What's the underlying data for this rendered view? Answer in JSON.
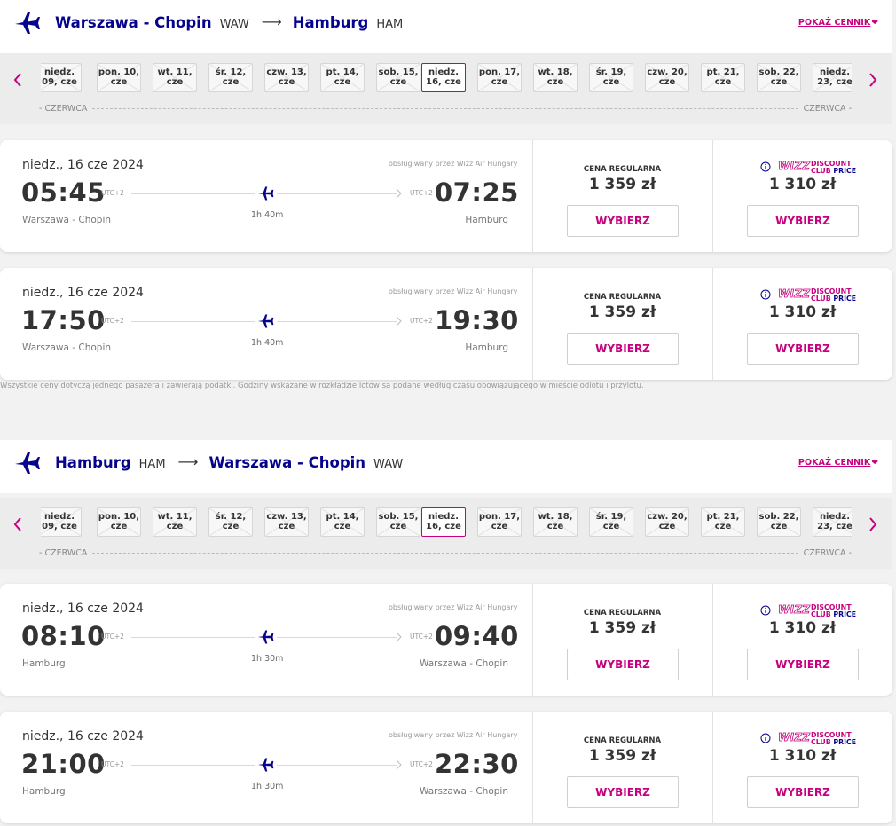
{
  "colors": {
    "brand_blue": "#06038d",
    "brand_pink": "#c6007e"
  },
  "routes": [
    {
      "from_city": "Warszawa - Chopin",
      "from_code": "WAW",
      "arrow": "⟶",
      "to_city": "Hamburg",
      "to_code": "HAM",
      "price_list_link": "POKAŻ CENNIK",
      "month_left": "CZERWCA",
      "month_right": "CZERWCA",
      "dates": [
        {
          "line1": "niedz.",
          "line2": "09, cze"
        },
        {
          "line1": "pon. 10,",
          "line2": "cze"
        },
        {
          "line1": "wt. 11,",
          "line2": "cze"
        },
        {
          "line1": "śr. 12,",
          "line2": "cze"
        },
        {
          "line1": "czw. 13,",
          "line2": "cze"
        },
        {
          "line1": "pt. 14,",
          "line2": "cze"
        },
        {
          "line1": "sob. 15,",
          "line2": "cze"
        },
        {
          "line1": "niedz.",
          "line2": "16, cze",
          "selected": true
        },
        {
          "line1": "pon. 17,",
          "line2": "cze"
        },
        {
          "line1": "wt. 18,",
          "line2": "cze"
        },
        {
          "line1": "śr. 19,",
          "line2": "cze"
        },
        {
          "line1": "czw. 20,",
          "line2": "cze"
        },
        {
          "line1": "pt. 21,",
          "line2": "cze"
        },
        {
          "line1": "sob. 22,",
          "line2": "cze"
        },
        {
          "line1": "niedz.",
          "line2": "23, cze"
        }
      ],
      "flights": [
        {
          "date": "niedz., 16 cze 2024",
          "operated_by": "obsługiwany przez Wizz Air Hungary",
          "dep_time": "05:45",
          "dep_utc": "UTC+2",
          "arr_time": "07:25",
          "arr_utc": "UTC+2",
          "duration": "1h 40m",
          "from": "Warszawa - Chopin",
          "to": "Hamburg",
          "regular_label": "CENA REGULARNA",
          "regular_price": "1 359 zł",
          "dc_price": "1 310 zł",
          "select_label": "WYBIERZ"
        },
        {
          "date": "niedz., 16 cze 2024",
          "operated_by": "obsługiwany przez Wizz Air Hungary",
          "dep_time": "17:50",
          "dep_utc": "UTC+2",
          "arr_time": "19:30",
          "arr_utc": "UTC+2",
          "duration": "1h 40m",
          "from": "Warszawa - Chopin",
          "to": "Hamburg",
          "regular_label": "CENA REGULARNA",
          "regular_price": "1 359 zł",
          "dc_price": "1 310 zł",
          "select_label": "WYBIERZ"
        }
      ]
    },
    {
      "from_city": "Hamburg",
      "from_code": "HAM",
      "arrow": "⟶",
      "to_city": "Warszawa - Chopin",
      "to_code": "WAW",
      "price_list_link": "POKAŻ CENNIK",
      "month_left": "CZERWCA",
      "month_right": "CZERWCA",
      "dates": [
        {
          "line1": "niedz.",
          "line2": "09, cze"
        },
        {
          "line1": "pon. 10,",
          "line2": "cze"
        },
        {
          "line1": "wt. 11,",
          "line2": "cze"
        },
        {
          "line1": "śr. 12,",
          "line2": "cze"
        },
        {
          "line1": "czw. 13,",
          "line2": "cze"
        },
        {
          "line1": "pt. 14,",
          "line2": "cze"
        },
        {
          "line1": "sob. 15,",
          "line2": "cze"
        },
        {
          "line1": "niedz.",
          "line2": "16, cze",
          "selected": true
        },
        {
          "line1": "pon. 17,",
          "line2": "cze"
        },
        {
          "line1": "wt. 18,",
          "line2": "cze"
        },
        {
          "line1": "śr. 19,",
          "line2": "cze"
        },
        {
          "line1": "czw. 20,",
          "line2": "cze"
        },
        {
          "line1": "pt. 21,",
          "line2": "cze"
        },
        {
          "line1": "sob. 22,",
          "line2": "cze"
        },
        {
          "line1": "niedz.",
          "line2": "23, cze"
        }
      ],
      "flights": [
        {
          "date": "niedz., 16 cze 2024",
          "operated_by": "obsługiwany przez Wizz Air Hungary",
          "dep_time": "08:10",
          "dep_utc": "UTC+2",
          "arr_time": "09:40",
          "arr_utc": "UTC+2",
          "duration": "1h 30m",
          "from": "Hamburg",
          "to": "Warszawa - Chopin",
          "regular_label": "CENA REGULARNA",
          "regular_price": "1 359 zł",
          "dc_price": "1 310 zł",
          "select_label": "WYBIERZ"
        },
        {
          "date": "niedz., 16 cze 2024",
          "operated_by": "obsługiwany przez Wizz Air Hungary",
          "dep_time": "21:00",
          "dep_utc": "UTC+2",
          "arr_time": "22:30",
          "arr_utc": "UTC+2",
          "duration": "1h 30m",
          "from": "Hamburg",
          "to": "Warszawa - Chopin",
          "regular_label": "CENA REGULARNA",
          "regular_price": "1 359 zł",
          "dc_price": "1 310 zł",
          "select_label": "WYBIERZ"
        }
      ]
    }
  ],
  "discount_club": {
    "brand": "WIZZ",
    "line1": "DISCOUNT",
    "line2_a": "CLUB ",
    "line2_b": "PRICE"
  },
  "footnote": "Wszystkie ceny dotyczą jednego pasażera i zawierają podatki. Godziny wskazane w rozkładzie lotów są podane według czasu obowiązującego w mieście odlotu i przylotu."
}
